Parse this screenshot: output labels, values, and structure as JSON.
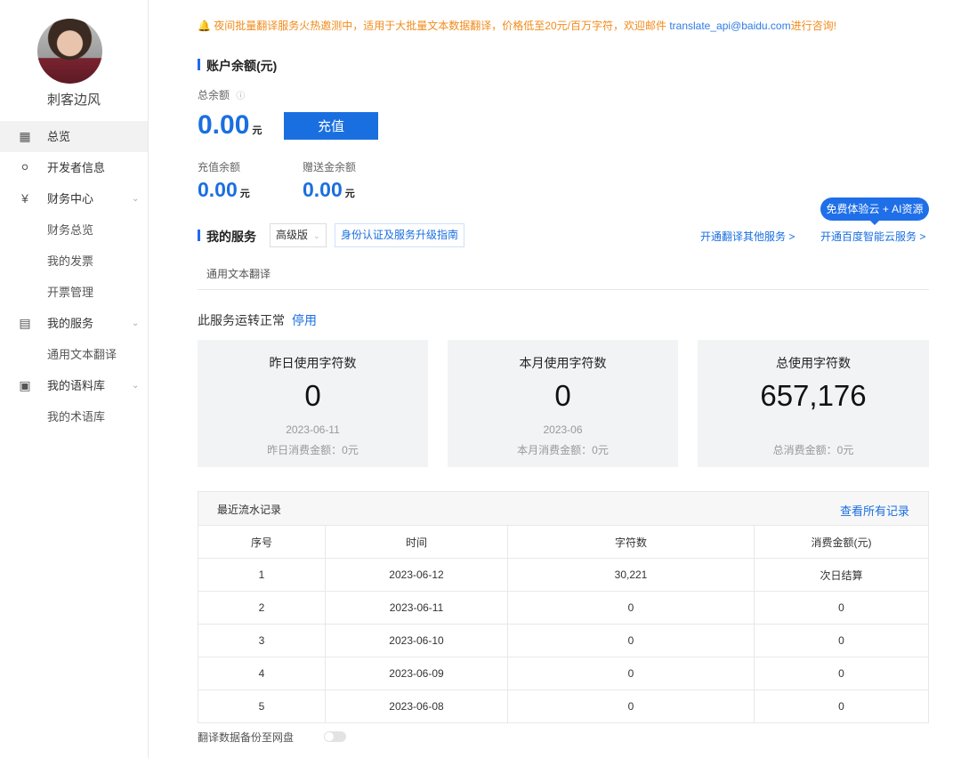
{
  "user": {
    "name": "刺客边风"
  },
  "nav": {
    "overview": "总览",
    "developer": "开发者信息",
    "finance": "财务中心",
    "finance_overview": "财务总览",
    "my_invoices": "我的发票",
    "invoice_manage": "开票管理",
    "my_services": "我的服务",
    "general_translate": "通用文本翻译",
    "corpus": "我的语料库",
    "terms": "我的术语库"
  },
  "notice": {
    "text": "夜间批量翻译服务火热邀测中，适用于大批量文本数据翻译，价格低至20元/百万字符，欢迎邮件 ",
    "email": "translate_api@baidu.com",
    "suffix": "进行咨询!"
  },
  "balance": {
    "title": "账户余额(元)",
    "total_label": "总余额",
    "total": "0.00",
    "unit": "元",
    "recharge": "充值",
    "recharge_label": "充值余额",
    "recharge_value": "0.00",
    "gift_label": "赠送金余额",
    "gift_value": "0.00"
  },
  "services": {
    "title": "我的服务",
    "edition": "高级版",
    "guide": "身份认证及服务升级指南",
    "open_other": "开通翻译其他服务 >",
    "open_cloud": "开通百度智能云服务 >",
    "bubble": "免费体验云 + AI资源",
    "tab": "通用文本翻译",
    "status": "此服务运转正常",
    "stop": "停用"
  },
  "cards": [
    {
      "title": "昨日使用字符数",
      "value": "0",
      "date": "2023-06-11",
      "fee": "昨日消费金额：0元"
    },
    {
      "title": "本月使用字符数",
      "value": "0",
      "date": "2023-06",
      "fee": "本月消费金额：0元"
    },
    {
      "title": "总使用字符数",
      "value": "657,176",
      "date": "",
      "fee": "总消费金额：0元"
    }
  ],
  "records": {
    "title": "最近流水记录",
    "view_all": "查看所有记录",
    "headers": [
      "序号",
      "时间",
      "字符数",
      "消费金额(元)"
    ],
    "rows": [
      [
        "1",
        "2023-06-12",
        "30,221",
        "次日结算"
      ],
      [
        "2",
        "2023-06-11",
        "0",
        "0"
      ],
      [
        "3",
        "2023-06-10",
        "0",
        "0"
      ],
      [
        "4",
        "2023-06-09",
        "0",
        "0"
      ],
      [
        "5",
        "2023-06-08",
        "0",
        "0"
      ]
    ]
  },
  "backup": {
    "label": "翻译数据备份至网盘"
  }
}
